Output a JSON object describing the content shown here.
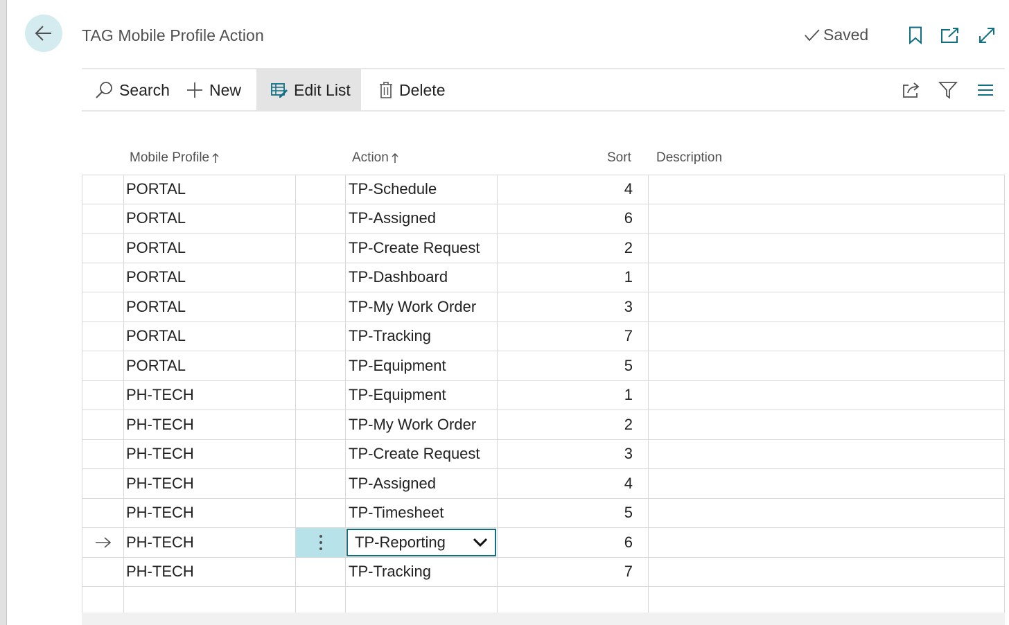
{
  "page": {
    "title": "TAG Mobile Profile Action",
    "saved_label": "Saved"
  },
  "icons": {
    "back": "arrow-left-icon",
    "saved": "checkmark-icon",
    "bookmark": "bookmark-icon",
    "open_new": "open-in-new-window-icon",
    "expand": "expand-icon",
    "search": "search-icon",
    "new": "plus-icon",
    "edit_list": "edit-list-icon",
    "delete": "trash-icon",
    "share": "share-icon",
    "filter": "filter-icon",
    "list_view": "list-view-icon"
  },
  "toolbar": {
    "search_label": "Search",
    "new_label": "New",
    "edit_list_label": "Edit List",
    "delete_label": "Delete"
  },
  "table": {
    "columns": {
      "profile": "Mobile Profile",
      "action": "Action",
      "sort": "Sort",
      "description": "Description"
    },
    "rows": [
      {
        "profile": "PORTAL",
        "action": "TP-Schedule",
        "sort": "4",
        "description": ""
      },
      {
        "profile": "PORTAL",
        "action": "TP-Assigned",
        "sort": "6",
        "description": ""
      },
      {
        "profile": "PORTAL",
        "action": "TP-Create Request",
        "sort": "2",
        "description": ""
      },
      {
        "profile": "PORTAL",
        "action": "TP-Dashboard",
        "sort": "1",
        "description": ""
      },
      {
        "profile": "PORTAL",
        "action": "TP-My Work Order",
        "sort": "3",
        "description": ""
      },
      {
        "profile": "PORTAL",
        "action": "TP-Tracking",
        "sort": "7",
        "description": ""
      },
      {
        "profile": "PORTAL",
        "action": "TP-Equipment",
        "sort": "5",
        "description": ""
      },
      {
        "profile": "PH-TECH",
        "action": "TP-Equipment",
        "sort": "1",
        "description": ""
      },
      {
        "profile": "PH-TECH",
        "action": "TP-My Work Order",
        "sort": "2",
        "description": ""
      },
      {
        "profile": "PH-TECH",
        "action": "TP-Create Request",
        "sort": "3",
        "description": ""
      },
      {
        "profile": "PH-TECH",
        "action": "TP-Assigned",
        "sort": "4",
        "description": ""
      },
      {
        "profile": "PH-TECH",
        "action": "TP-Timesheet",
        "sort": "5",
        "description": ""
      },
      {
        "profile": "PH-TECH",
        "action": "TP-Reporting",
        "sort": "6",
        "description": "",
        "current": true
      },
      {
        "profile": "PH-TECH",
        "action": "TP-Tracking",
        "sort": "7",
        "description": ""
      },
      {
        "profile": "",
        "action": "",
        "sort": "",
        "description": ""
      }
    ]
  },
  "colors": {
    "accent": "#0f6f83",
    "active_cell": "#b8e2ea",
    "back_button": "#d4ecf0"
  }
}
